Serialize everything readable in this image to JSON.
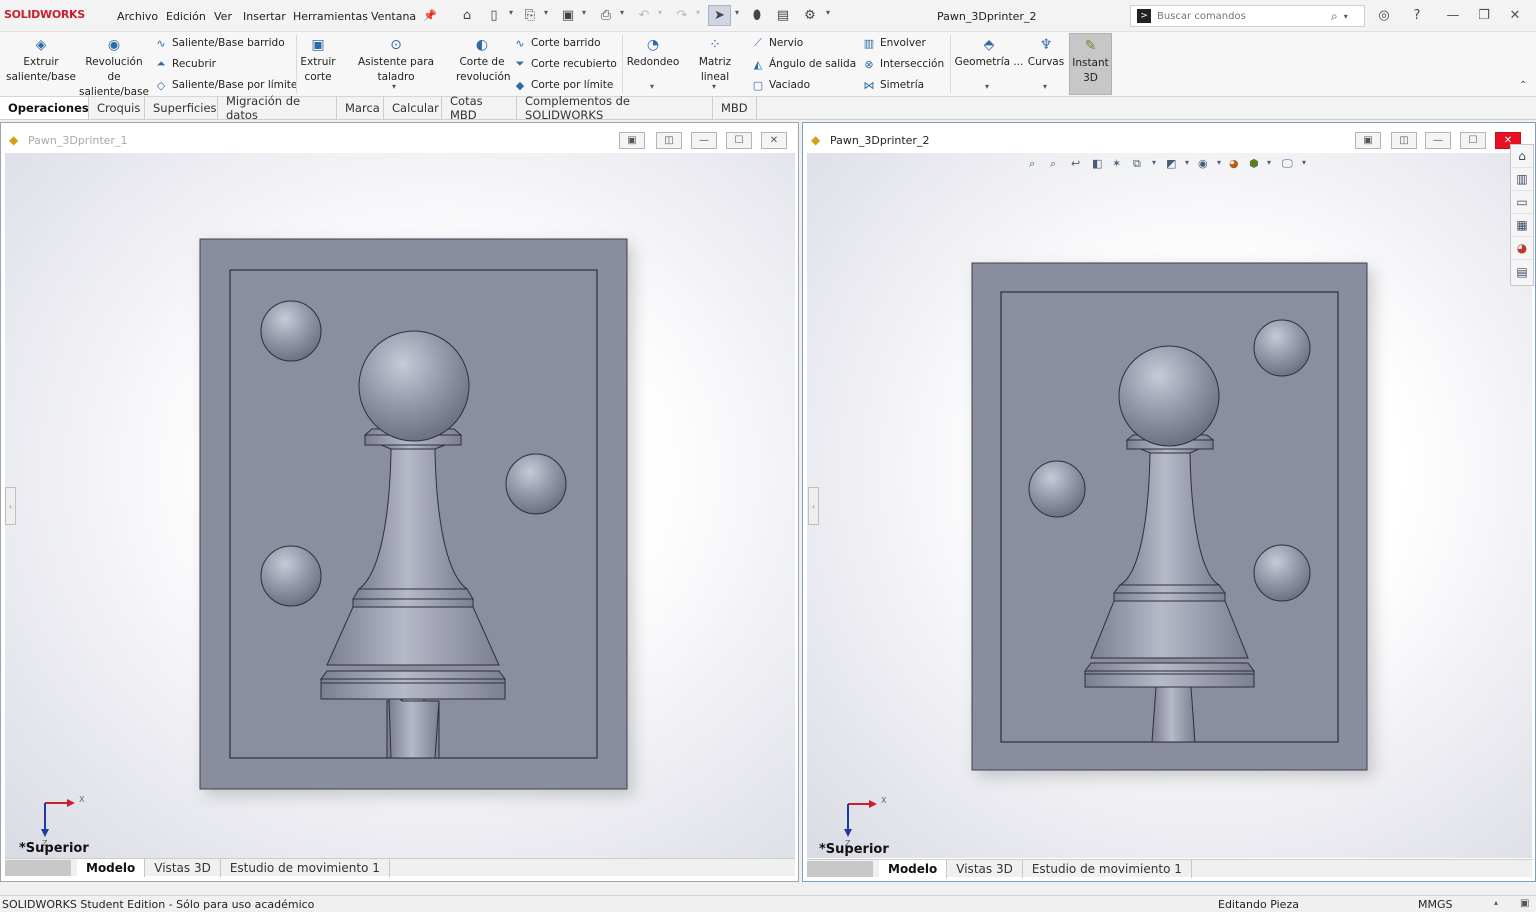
{
  "app": {
    "brand": "SOLIDWORKS",
    "doc_title": "Pawn_3Dprinter_2"
  },
  "menu": [
    "Archivo",
    "Edición",
    "Ver",
    "Insertar",
    "Herramientas",
    "Ventana"
  ],
  "search": {
    "placeholder": "Buscar comandos"
  },
  "ribbon": {
    "extrude_boss": "Extruir\nsaliente/base",
    "revolve_boss": "Revolución de\nsaliente/base",
    "swept_boss": "Saliente/Base barrido",
    "loft_boss": "Recubrir",
    "boundary_boss": "Saliente/Base por límite",
    "extrude_cut": "Extruir\ncorte",
    "hole_wizard": "Asistente para taladro",
    "revolve_cut": "Corte de\nrevolución",
    "swept_cut": "Corte barrido",
    "lofted_cut": "Corte recubierto",
    "boundary_cut": "Corte por límite",
    "fillet": "Redondeo",
    "linear_pattern": "Matriz lineal",
    "rib": "Nervio",
    "draft": "Ángulo de salida",
    "shell": "Vaciado",
    "wrap": "Envolver",
    "intersect": "Intersección",
    "mirror": "Simetría",
    "geometry": "Geometría ...",
    "curves": "Curvas",
    "instant3d": "Instant\n3D"
  },
  "cm_tabs": [
    "Operaciones",
    "Croquis",
    "Superficies",
    "Migración de datos",
    "Marca",
    "Calcular",
    "Cotas MBD",
    "Complementos de SOLIDWORKS",
    "MBD"
  ],
  "doc1": {
    "title": "Pawn_3Dprinter_1",
    "view_label": "*Superior"
  },
  "doc2": {
    "title": "Pawn_3Dprinter_2",
    "view_label": "*Superior"
  },
  "bottom_tabs": [
    "Modelo",
    "Vistas 3D",
    "Estudio de movimiento 1"
  ],
  "triad": {
    "x": "X",
    "z": "Z"
  },
  "status": {
    "left": "SOLIDWORKS Student Edition - Sólo para uso académico",
    "mode": "Editando Pieza",
    "units": "MMGS"
  },
  "colors": {
    "part": "#8a8d9e",
    "accent": "#c8202f",
    "close": "#e81123"
  },
  "icons": [
    "home-icon",
    "new-icon",
    "open-icon",
    "save-icon",
    "print-icon",
    "undo-icon",
    "redo-icon",
    "select-icon",
    "rebuild-icon",
    "options-icon",
    "help-icon"
  ]
}
